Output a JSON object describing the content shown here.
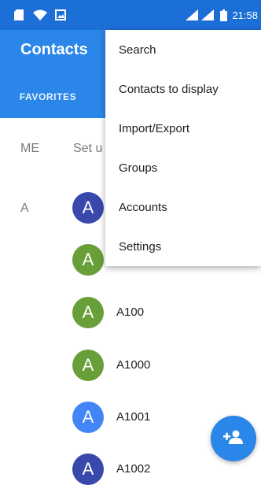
{
  "status_bar": {
    "time": "21:58",
    "icons": [
      "sd-card-icon",
      "wifi-icon",
      "image-icon",
      "signal-icon",
      "signal-icon",
      "battery-icon"
    ]
  },
  "app": {
    "title": "Contacts",
    "tabs": [
      {
        "label": "FAVORITES"
      }
    ]
  },
  "me_section": {
    "letter": "ME",
    "hint": "Set u"
  },
  "contacts": [
    {
      "letter": "A",
      "avatar_letter": "A",
      "avatar_color": "#3949ab",
      "name": ""
    },
    {
      "letter": "",
      "avatar_letter": "A",
      "avatar_color": "#689f38",
      "name": ""
    },
    {
      "letter": "",
      "avatar_letter": "A",
      "avatar_color": "#689f38",
      "name": "A100"
    },
    {
      "letter": "",
      "avatar_letter": "A",
      "avatar_color": "#689f38",
      "name": "A1000"
    },
    {
      "letter": "",
      "avatar_letter": "A",
      "avatar_color": "#4285f4",
      "name": "A1001"
    },
    {
      "letter": "",
      "avatar_letter": "A",
      "avatar_color": "#3949ab",
      "name": "A1002"
    }
  ],
  "overflow_menu": {
    "items": [
      {
        "label": "Search"
      },
      {
        "label": "Contacts to display"
      },
      {
        "label": "Import/Export"
      },
      {
        "label": "Groups"
      },
      {
        "label": "Accounts"
      },
      {
        "label": "Settings"
      }
    ]
  },
  "fab": {
    "icon": "add-contact-icon"
  },
  "colors": {
    "primary": "#2a86e8",
    "status_bar": "#1d6fd8"
  }
}
